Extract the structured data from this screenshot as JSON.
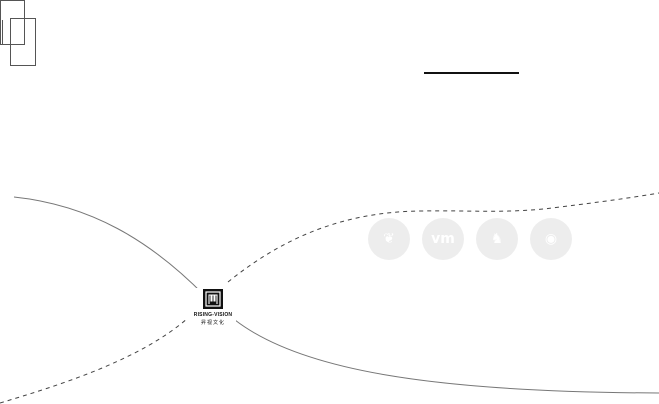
{
  "brand": {
    "name": "RISING-VISION",
    "subtitle": "昇视文化"
  },
  "social": [
    {
      "name": "weibo-icon",
      "glyph": "❦"
    },
    {
      "name": "vimeo-icon",
      "glyph": "vm"
    },
    {
      "name": "qq-icon",
      "glyph": "♞"
    },
    {
      "name": "eye-icon",
      "glyph": "◉"
    }
  ],
  "colors": {
    "background": "#ffffff",
    "curve": "#666666",
    "icon_fill": "#ededed",
    "logo": "#111111"
  }
}
